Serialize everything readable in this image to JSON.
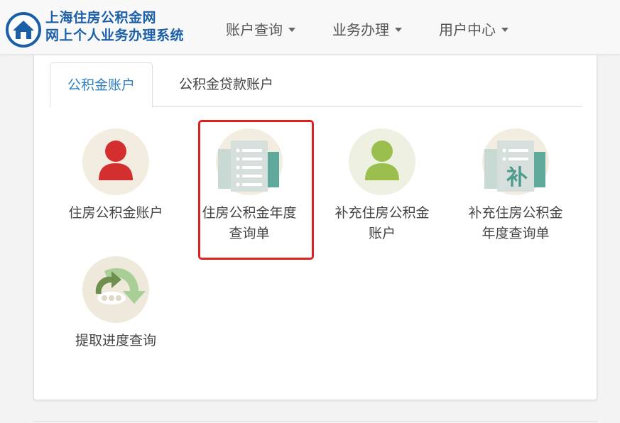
{
  "header": {
    "logo_line1": "上海住房公积金网",
    "logo_line2": "网上个人业务办理系统",
    "nav": [
      {
        "label": "账户查询"
      },
      {
        "label": "业务办理"
      },
      {
        "label": "用户中心"
      }
    ]
  },
  "tabs": [
    {
      "label": "公积金账户",
      "active": true
    },
    {
      "label": "公积金贷款账户",
      "active": false
    }
  ],
  "tiles": [
    {
      "label": "住房公积金账户",
      "icon": "person-red-icon"
    },
    {
      "label": "住房公积金年度查询单",
      "icon": "document-list-icon",
      "highlighted": true
    },
    {
      "label": "补充住房公积金账户",
      "icon": "person-green-icon"
    },
    {
      "label": "补充住房公积金年度查询单",
      "icon": "supplement-document-icon"
    },
    {
      "label": "提取进度查询",
      "icon": "progress-arrow-icon"
    }
  ],
  "tile_icon_glyph_4": "补",
  "colors": {
    "brand": "#1a5fa8",
    "tab_active": "#2e7ec2",
    "highlight": "#e02020",
    "person_red": "#d32f2f",
    "person_green": "#9bbf4e",
    "icon_bg": "#f2ede0"
  }
}
